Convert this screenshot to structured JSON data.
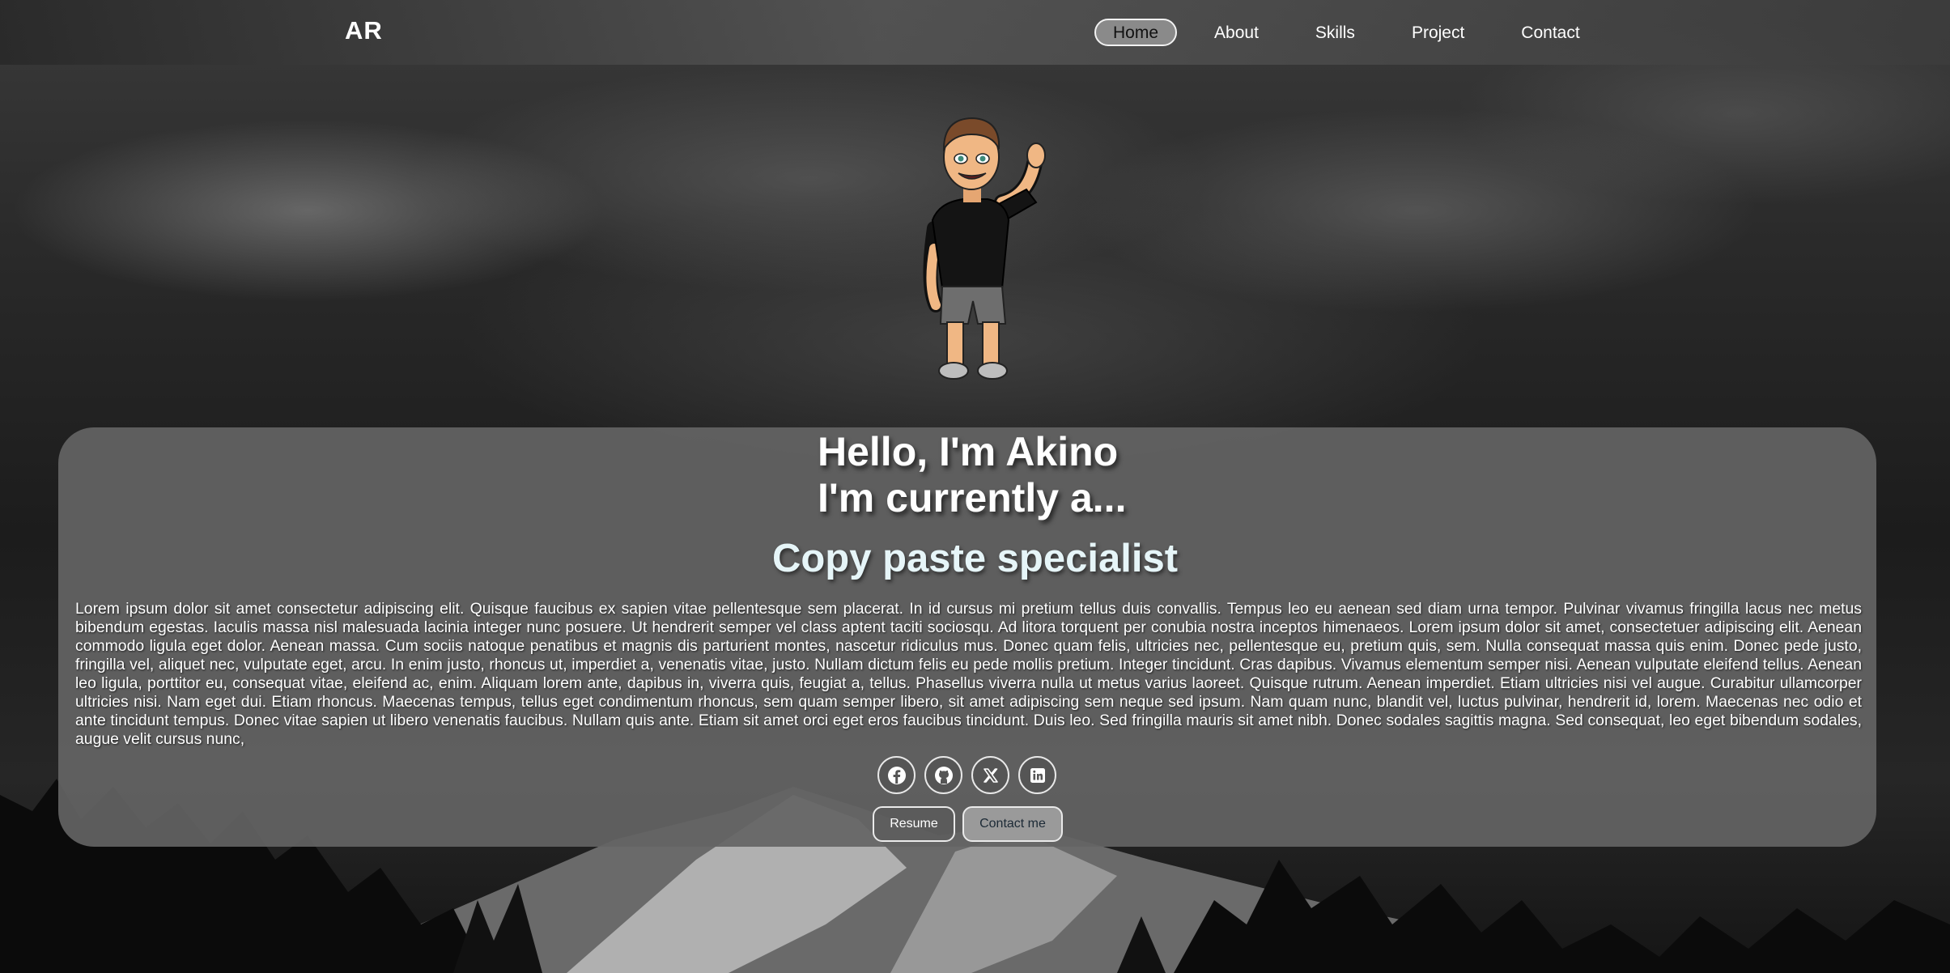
{
  "nav": {
    "logo": "AR",
    "links": [
      {
        "label": "Home",
        "active": true
      },
      {
        "label": "About",
        "active": false
      },
      {
        "label": "Skills",
        "active": false
      },
      {
        "label": "Project",
        "active": false
      },
      {
        "label": "Contact",
        "active": false
      }
    ]
  },
  "hero": {
    "greeting_line1": "Hello, I'm Akino",
    "greeting_line2": "I'm currently a...",
    "role": "Copy paste specialist",
    "bio": "Lorem ipsum dolor sit amet consectetur adipiscing elit. Quisque faucibus ex sapien vitae pellentesque sem placerat. In id cursus mi pretium tellus duis convallis. Tempus leo eu aenean sed diam urna tempor. Pulvinar vivamus fringilla lacus nec metus bibendum egestas. Iaculis massa nisl malesuada lacinia integer nunc posuere. Ut hendrerit semper vel class aptent taciti sociosqu. Ad litora torquent per conubia nostra inceptos himenaeos. Lorem ipsum dolor sit amet, consectetuer adipiscing elit. Aenean commodo ligula eget dolor. Aenean massa. Cum sociis natoque penatibus et magnis dis parturient montes, nascetur ridiculus mus. Donec quam felis, ultricies nec, pellentesque eu, pretium quis, sem. Nulla consequat massa quis enim. Donec pede justo, fringilla vel, aliquet nec, vulputate eget, arcu. In enim justo, rhoncus ut, imperdiet a, venenatis vitae, justo. Nullam dictum felis eu pede mollis pretium. Integer tincidunt. Cras dapibus. Vivamus elementum semper nisi. Aenean vulputate eleifend tellus. Aenean leo ligula, porttitor eu, consequat vitae, eleifend ac, enim. Aliquam lorem ante, dapibus in, viverra quis, feugiat a, tellus. Phasellus viverra nulla ut metus varius laoreet. Quisque rutrum. Aenean imperdiet. Etiam ultricies nisi vel augue. Curabitur ullamcorper ultricies nisi. Nam eget dui. Etiam rhoncus. Maecenas tempus, tellus eget condimentum rhoncus, sem quam semper libero, sit amet adipiscing sem neque sed ipsum. Nam quam nunc, blandit vel, luctus pulvinar, hendrerit id, lorem. Maecenas nec odio et ante tincidunt tempus. Donec vitae sapien ut libero venenatis faucibus. Nullam quis ante. Etiam sit amet orci eget eros faucibus tincidunt. Duis leo. Sed fringilla mauris sit amet nibh. Donec sodales sagittis magna. Sed consequat, leo eget bibendum sodales, augue velit cursus nunc,"
  },
  "socials": [
    {
      "icon": "facebook-icon"
    },
    {
      "icon": "github-icon"
    },
    {
      "icon": "x-icon"
    },
    {
      "icon": "linkedin-icon"
    }
  ],
  "buttons": {
    "resume": "Resume",
    "contact": "Contact me"
  },
  "colors": {
    "card": "#646464",
    "active_nav": "#8a8a8a",
    "role_text": "#e6f5f8"
  }
}
